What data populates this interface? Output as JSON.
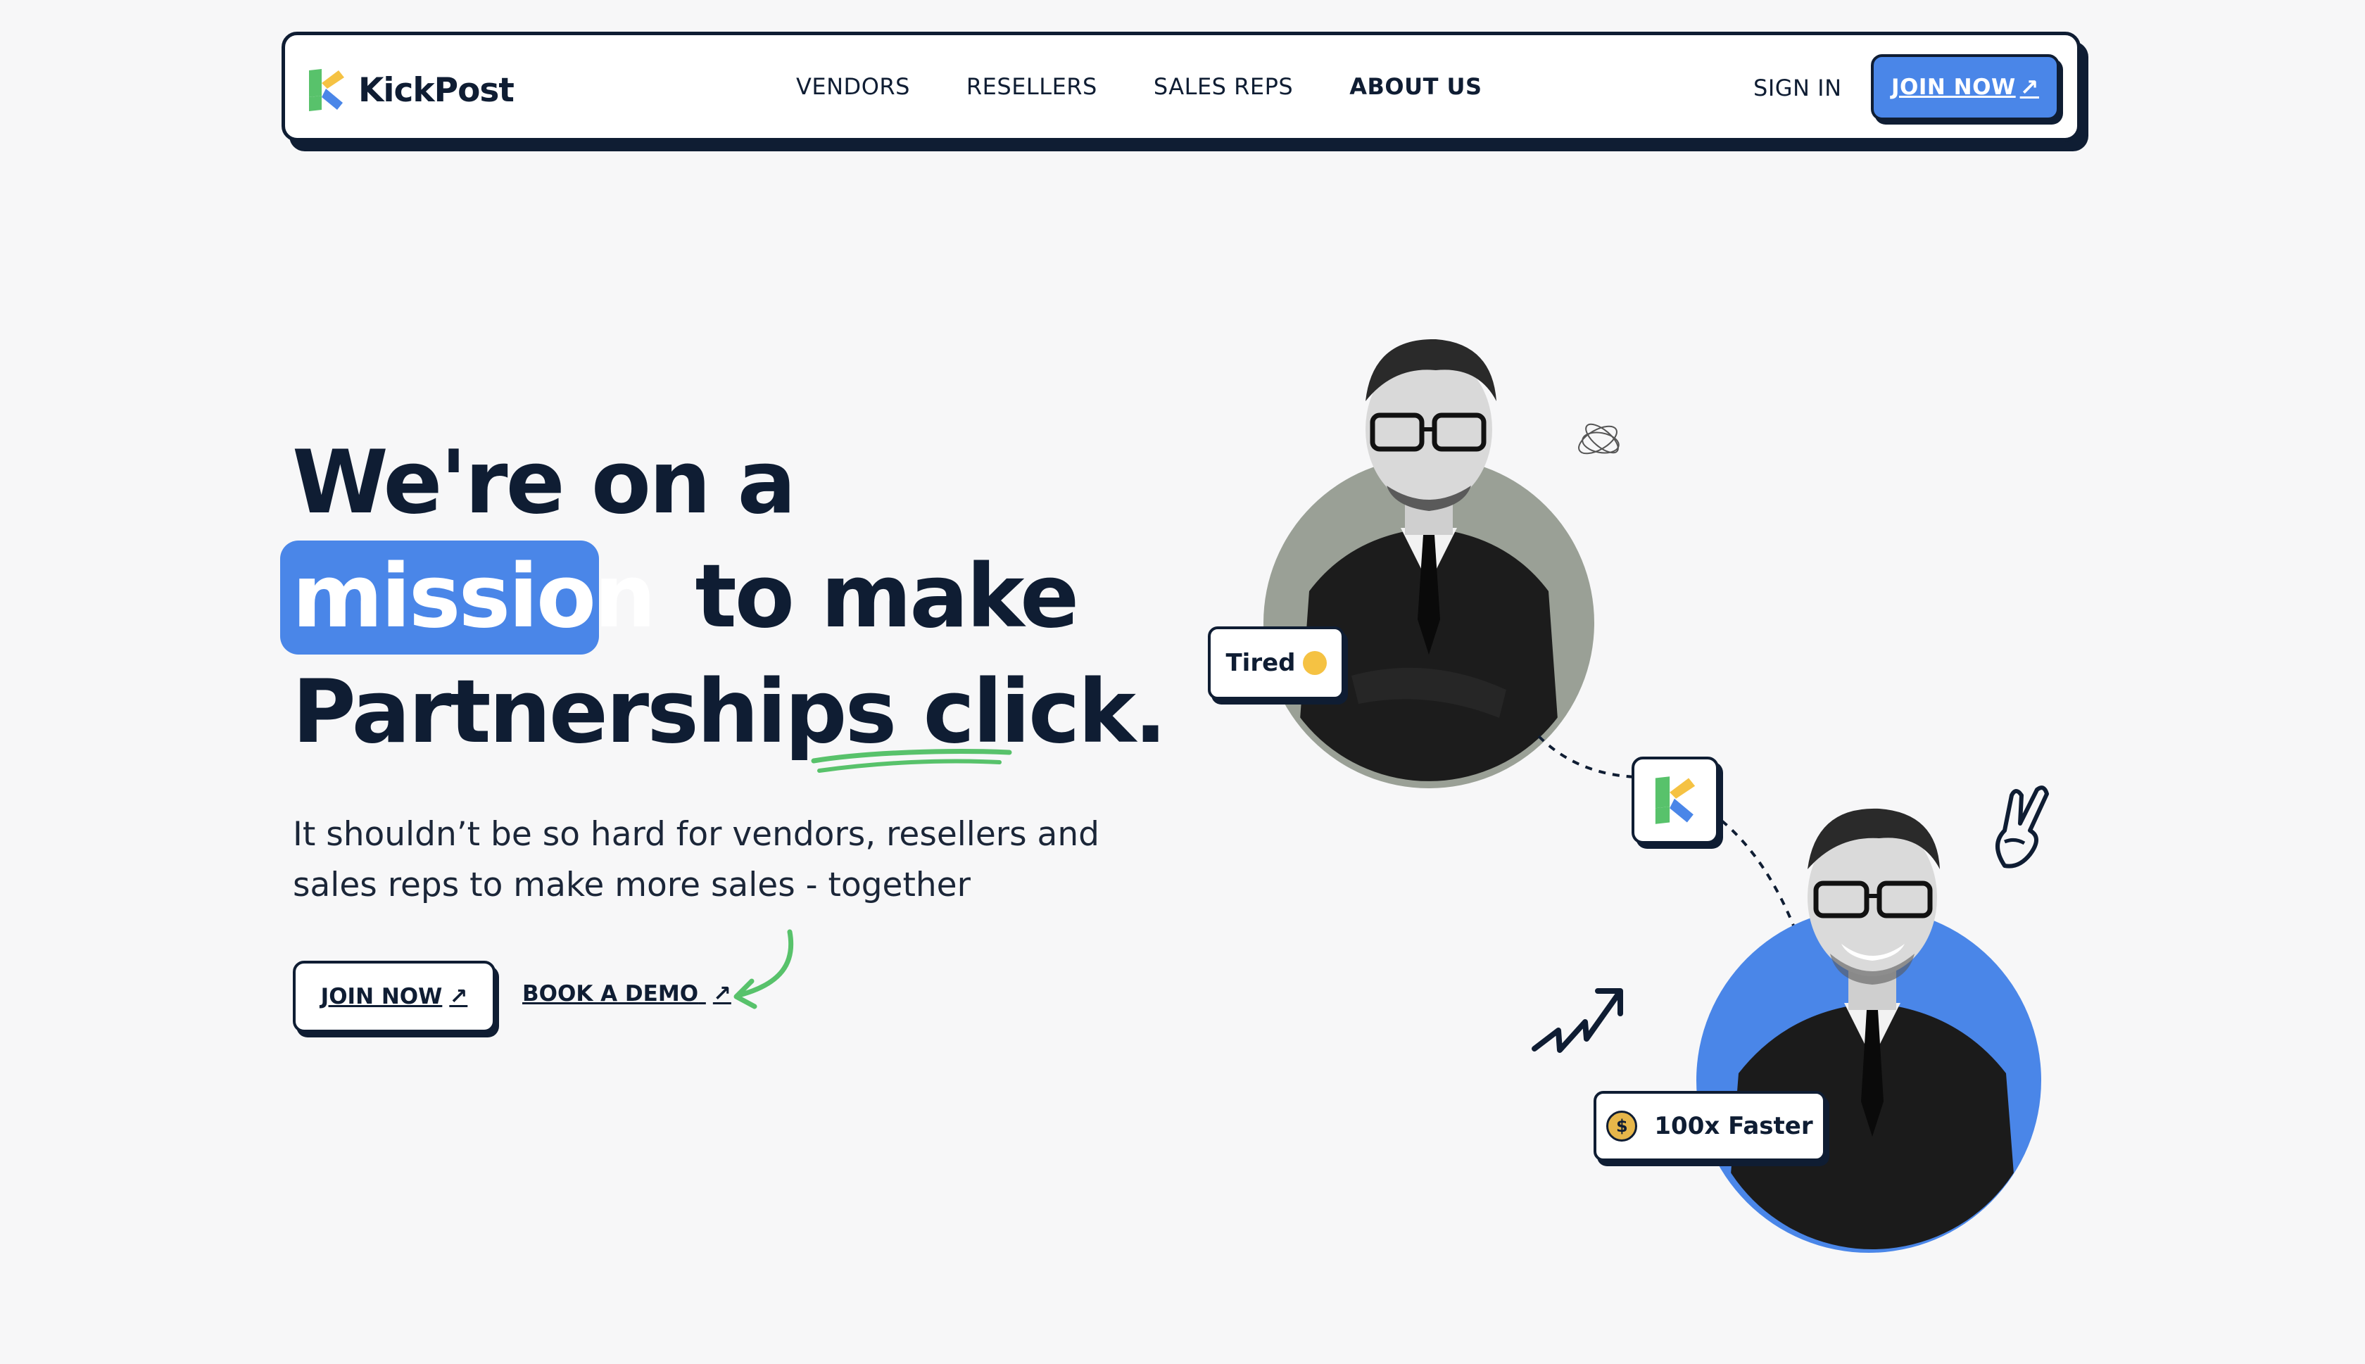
{
  "brand": {
    "name": "KickPost"
  },
  "nav": {
    "links": [
      {
        "label": "VENDORS",
        "active": false
      },
      {
        "label": "RESELLERS",
        "active": false
      },
      {
        "label": "SALES REPS",
        "active": false
      },
      {
        "label": "ABOUT US",
        "active": true
      }
    ],
    "sign_in": "SIGN IN",
    "join_now": "JOIN NOW"
  },
  "hero": {
    "line1": "We're on a",
    "line2_highlight": "mission",
    "line2_rest": "to make",
    "line3": "Partnerships click.",
    "subtitle": "It shouldn’t be so hard for vendors, resellers and sales reps to make more sales - together",
    "join_now": "JOIN NOW",
    "book_demo": "BOOK A DEMO"
  },
  "illustration": {
    "badge_top": "Tired",
    "badge_bottom": "100x Faster",
    "coin_symbol": "$"
  },
  "colors": {
    "accent": "#4a86e8",
    "navy": "#0f1d33",
    "green": "#58c26b",
    "background": "#f7f7f8"
  },
  "icons": [
    "kickpost-logo-icon",
    "arrow-up-right-icon",
    "curved-arrow-icon",
    "scribble-icon",
    "peace-hand-icon",
    "zigzag-arrow-icon",
    "coin-icon",
    "tired-emoji-icon"
  ]
}
